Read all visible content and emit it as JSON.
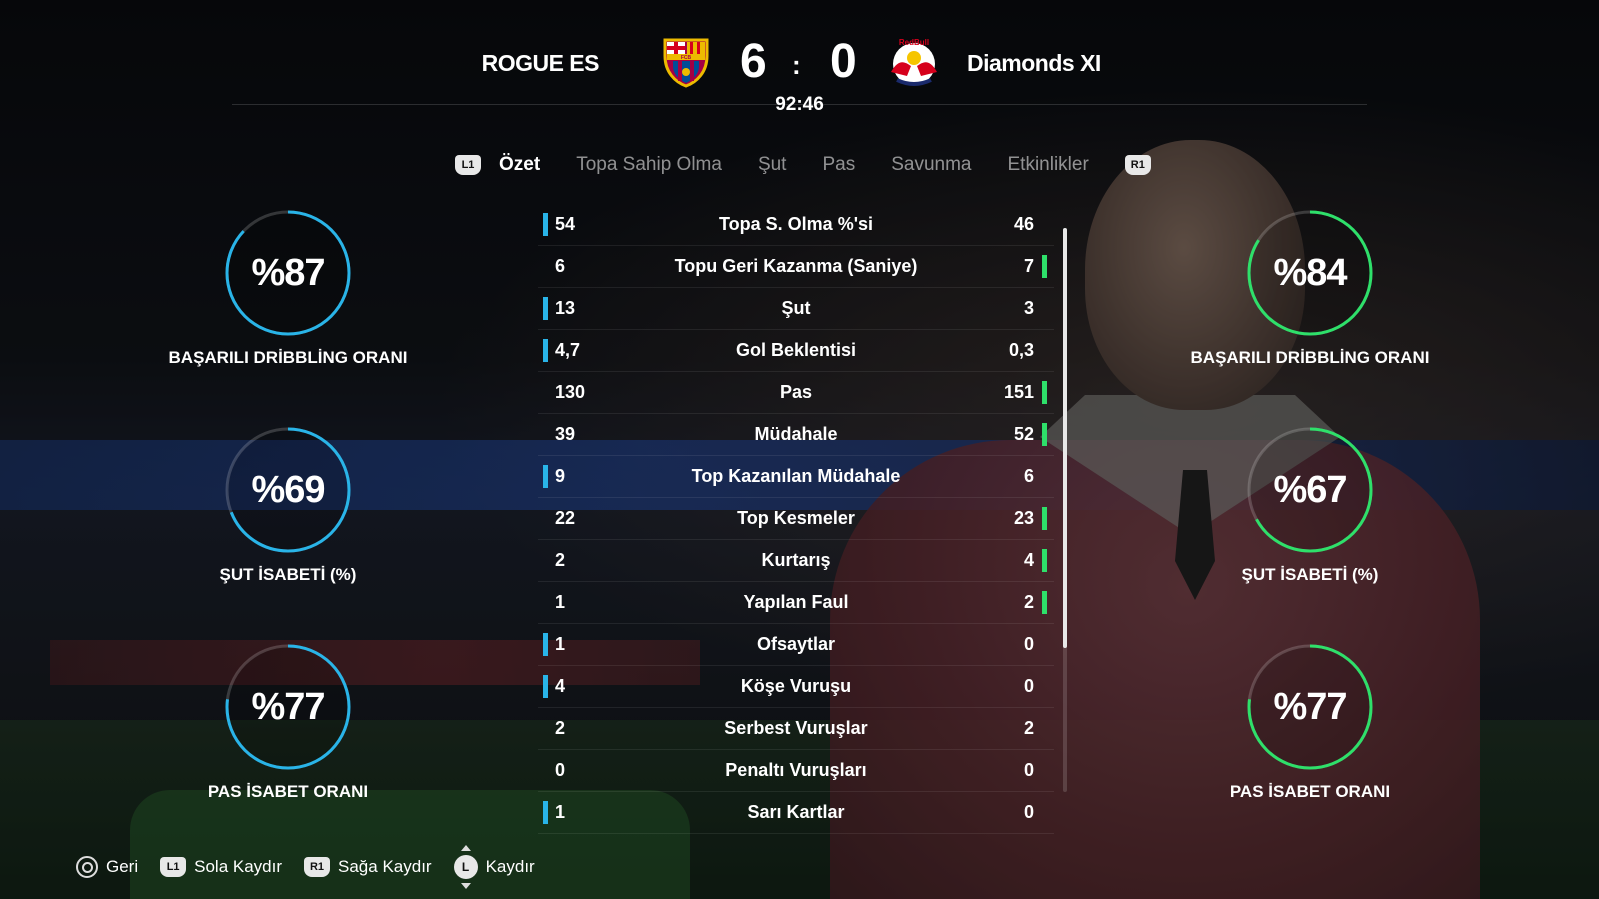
{
  "header": {
    "home_team": "ROGUE ES",
    "away_team": "Diamonds XI",
    "home_score": "6",
    "away_score": "0",
    "separator": ":",
    "clock": "92:46",
    "home_crest_text": "FCB",
    "away_crest_text": "RedBull"
  },
  "tabs": {
    "left_button": "L1",
    "right_button": "R1",
    "items": [
      "Özet",
      "Topa Sahip Olma",
      "Şut",
      "Pas",
      "Savunma",
      "Etkinlikler"
    ],
    "active": "Özet"
  },
  "home_rings": [
    {
      "pct": "%87",
      "value": 87,
      "label": "BAŞARILI DRİBBLİNG ORANI"
    },
    {
      "pct": "%69",
      "value": 69,
      "label": "ŞUT İSABETİ (%)"
    },
    {
      "pct": "%77",
      "value": 77,
      "label": "PAS İSABET ORANI"
    }
  ],
  "away_rings": [
    {
      "pct": "%84",
      "value": 84,
      "label": "BAŞARILI DRİBBLİNG ORANI"
    },
    {
      "pct": "%67",
      "value": 67,
      "label": "ŞUT İSABETİ (%)"
    },
    {
      "pct": "%77",
      "value": 77,
      "label": "PAS İSABET ORANI"
    }
  ],
  "colors": {
    "home_accent": "#29b4e8",
    "away_accent": "#2ee06a"
  },
  "stats": [
    {
      "label": "Topa S. Olma %'si",
      "home": "54",
      "away": "46",
      "leader": "home"
    },
    {
      "label": "Topu Geri Kazanma (Saniye)",
      "home": "6",
      "away": "7",
      "leader": "away"
    },
    {
      "label": "Şut",
      "home": "13",
      "away": "3",
      "leader": "home"
    },
    {
      "label": "Gol Beklentisi",
      "home": "4,7",
      "away": "0,3",
      "leader": "home"
    },
    {
      "label": "Pas",
      "home": "130",
      "away": "151",
      "leader": "away"
    },
    {
      "label": "Müdahale",
      "home": "39",
      "away": "52",
      "leader": "away"
    },
    {
      "label": "Top Kazanılan Müdahale",
      "home": "9",
      "away": "6",
      "leader": "home"
    },
    {
      "label": "Top Kesmeler",
      "home": "22",
      "away": "23",
      "leader": "away"
    },
    {
      "label": "Kurtarış",
      "home": "2",
      "away": "4",
      "leader": "away"
    },
    {
      "label": "Yapılan Faul",
      "home": "1",
      "away": "2",
      "leader": "away"
    },
    {
      "label": "Ofsaytlar",
      "home": "1",
      "away": "0",
      "leader": "home"
    },
    {
      "label": "Köşe Vuruşu",
      "home": "4",
      "away": "0",
      "leader": "home"
    },
    {
      "label": "Serbest Vuruşlar",
      "home": "2",
      "away": "2",
      "leader": "none"
    },
    {
      "label": "Penaltı Vuruşları",
      "home": "0",
      "away": "0",
      "leader": "none"
    },
    {
      "label": "Sarı Kartlar",
      "home": "1",
      "away": "0",
      "leader": "home"
    }
  ],
  "footer": {
    "back": "Geri",
    "l1_badge": "L1",
    "scroll_left": "Sola Kaydır",
    "r1_badge": "R1",
    "scroll_right": "Sağa Kaydır",
    "stick_badge": "L",
    "scroll": "Kaydır"
  }
}
